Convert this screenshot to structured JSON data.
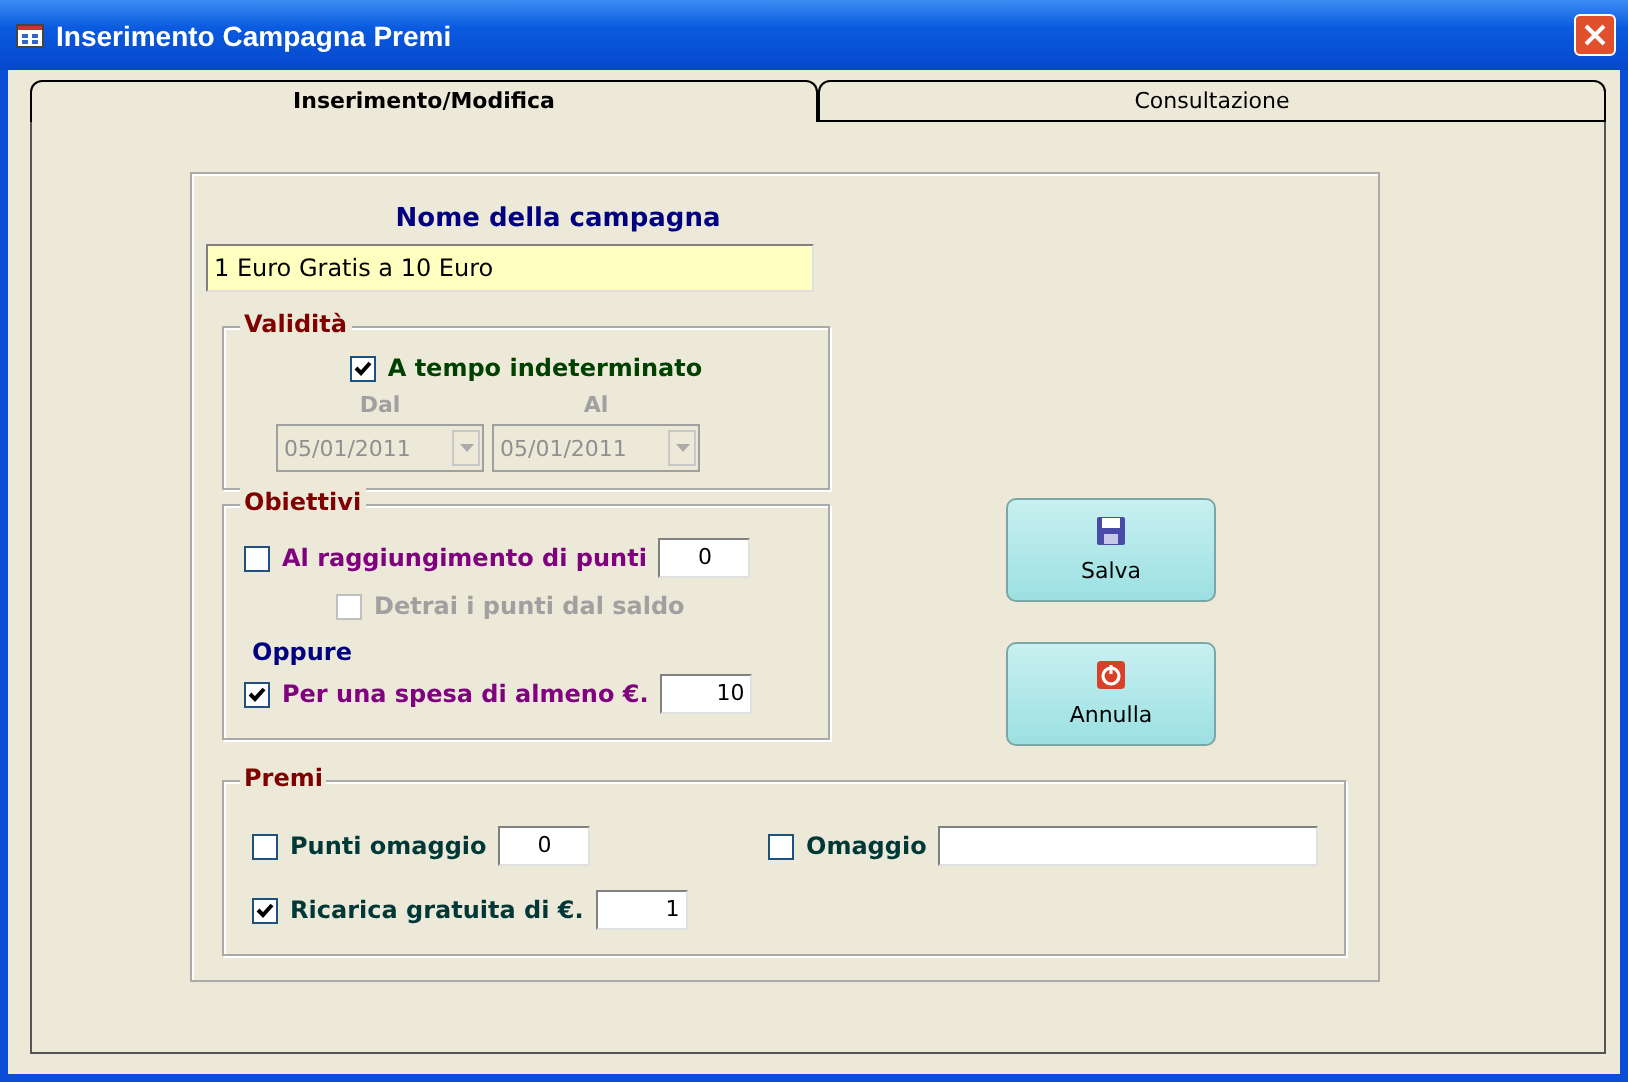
{
  "window": {
    "title": "Inserimento Campagna Premi"
  },
  "tabs": [
    {
      "label": "Inserimento/Modifica",
      "selected": true
    },
    {
      "label": "Consultazione",
      "selected": false
    }
  ],
  "name_field": {
    "label": "Nome della campagna",
    "value": "1 Euro Gratis a 10 Euro"
  },
  "validity": {
    "title": "Validità",
    "indefinite": {
      "label": "A tempo indeterminato",
      "checked": true
    },
    "from": {
      "label": "Dal",
      "value": "05/01/2011",
      "disabled": true
    },
    "to": {
      "label": "Al",
      "value": "05/01/2011",
      "disabled": true
    }
  },
  "objectives": {
    "title": "Obiettivi",
    "points": {
      "label": "Al raggiungimento di punti",
      "checked": false,
      "value": "0"
    },
    "deduct": {
      "label": "Detrai i punti dal saldo",
      "checked": false,
      "disabled": true
    },
    "or_label": "Oppure",
    "spend": {
      "label": "Per una spesa di almeno €.",
      "checked": true,
      "value": "10"
    }
  },
  "prizes": {
    "title": "Premi",
    "items": [
      {
        "label": "Punti omaggio",
        "checked": false,
        "kind": "number",
        "value": "0"
      },
      {
        "label": "Omaggio",
        "checked": false,
        "kind": "text"
      },
      {
        "label": "Ricarica gratuita di €.",
        "checked": true,
        "kind": "number",
        "value": "1"
      }
    ]
  },
  "buttons": [
    {
      "label": "Salva",
      "kind": "save"
    },
    {
      "label": "Annulla",
      "kind": "cancel"
    }
  ]
}
